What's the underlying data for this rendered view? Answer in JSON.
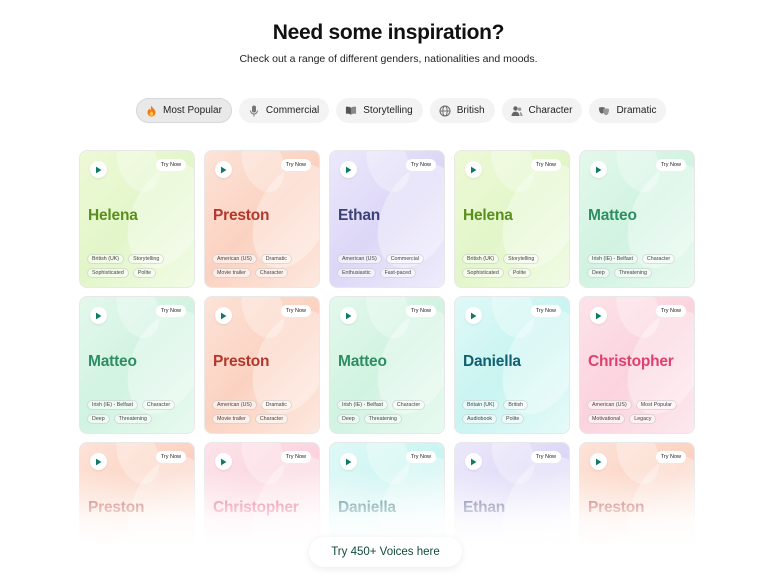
{
  "header": {
    "title": "Need some inspiration?",
    "subtitle": "Check out a range of different genders, nationalities and moods."
  },
  "filters": [
    {
      "label": "Most Popular",
      "icon": "flame-icon",
      "active": true
    },
    {
      "label": "Commercial",
      "icon": "microphone-icon",
      "active": false
    },
    {
      "label": "Storytelling",
      "icon": "book-icon",
      "active": false
    },
    {
      "label": "British",
      "icon": "globe-icon",
      "active": false
    },
    {
      "label": "Character",
      "icon": "people-icon",
      "active": false
    },
    {
      "label": "Dramatic",
      "icon": "masks-icon",
      "active": false
    }
  ],
  "try_label": "Try Now",
  "cards": [
    {
      "name": "Helena",
      "theme": "green",
      "tags": [
        "British (UK)",
        "Storytelling",
        "Sophisticated",
        "Polite"
      ]
    },
    {
      "name": "Preston",
      "theme": "peach",
      "tags": [
        "American (US)",
        "Dramatic",
        "Movie trailer",
        "Character"
      ]
    },
    {
      "name": "Ethan",
      "theme": "lav",
      "tags": [
        "American (US)",
        "Commercial",
        "Enthusiastic",
        "Fast-paced"
      ]
    },
    {
      "name": "Helena",
      "theme": "green",
      "tags": [
        "British (UK)",
        "Storytelling",
        "Sophisticated",
        "Polite"
      ]
    },
    {
      "name": "Matteo",
      "theme": "mint",
      "tags": [
        "Irish (IE) - Belfast",
        "Character",
        "Deep",
        "Threatening"
      ]
    },
    {
      "name": "Matteo",
      "theme": "mint",
      "tags": [
        "Irish (IE) - Belfast",
        "Character",
        "Deep",
        "Threatening"
      ]
    },
    {
      "name": "Preston",
      "theme": "peach",
      "tags": [
        "American (US)",
        "Dramatic",
        "Movie trailer",
        "Character"
      ]
    },
    {
      "name": "Matteo",
      "theme": "mint",
      "tags": [
        "Irish (IE) - Belfast",
        "Character",
        "Deep",
        "Threatening"
      ]
    },
    {
      "name": "Daniella",
      "theme": "aqua",
      "tags": [
        "Britain (UK)",
        "British",
        "Audiobook",
        "Polite"
      ]
    },
    {
      "name": "Christopher",
      "theme": "pink",
      "tags": [
        "American (US)",
        "Most Popular",
        "Motivational",
        "Legacy"
      ]
    },
    {
      "name": "Preston",
      "theme": "peach",
      "tags": []
    },
    {
      "name": "Christopher",
      "theme": "pink",
      "tags": []
    },
    {
      "name": "Daniella",
      "theme": "aqua",
      "tags": []
    },
    {
      "name": "Ethan",
      "theme": "lav",
      "tags": []
    },
    {
      "name": "Preston",
      "theme": "peach",
      "tags": []
    }
  ],
  "cta": {
    "label": "Try 450+ Voices here"
  },
  "colors": {
    "play": "#0f7a66",
    "cta_text": "#124a3c"
  }
}
